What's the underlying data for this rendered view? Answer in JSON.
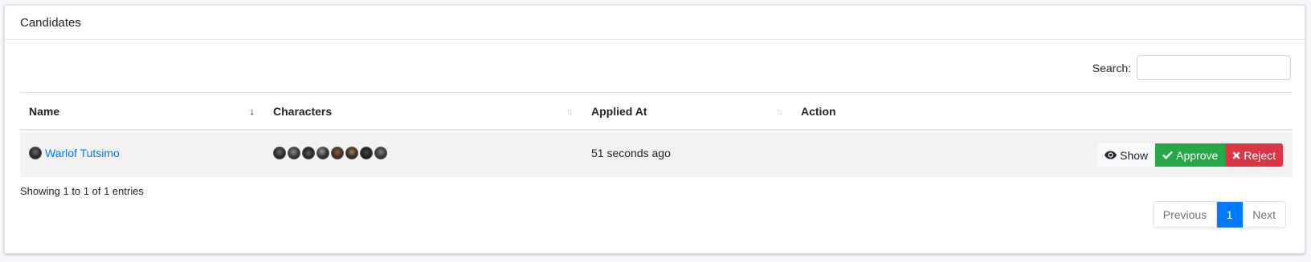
{
  "card": {
    "title": "Candidates"
  },
  "search": {
    "label": "Search:",
    "value": "",
    "placeholder": ""
  },
  "table": {
    "columns": [
      {
        "label": "Name",
        "sort": "descending"
      },
      {
        "label": "Characters",
        "sort": "none"
      },
      {
        "label": "Applied At",
        "sort": "none"
      },
      {
        "label": "Action",
        "sort": "disabled"
      }
    ],
    "rows": [
      {
        "name": "Warlof Tutsimo",
        "avatar_icon": "character-portrait",
        "characters_count": 8,
        "applied_at": "51 seconds ago",
        "actions": {
          "show_label": "Show",
          "approve_label": "Approve",
          "reject_label": "Reject"
        }
      }
    ]
  },
  "footer": {
    "info": "Showing 1 to 1 of 1 entries",
    "pagination": {
      "previous": "Previous",
      "current": "1",
      "next": "Next"
    }
  },
  "colors": {
    "link": "#007bff",
    "approve": "#28a745",
    "reject": "#dc3545",
    "page_active": "#007bff"
  }
}
